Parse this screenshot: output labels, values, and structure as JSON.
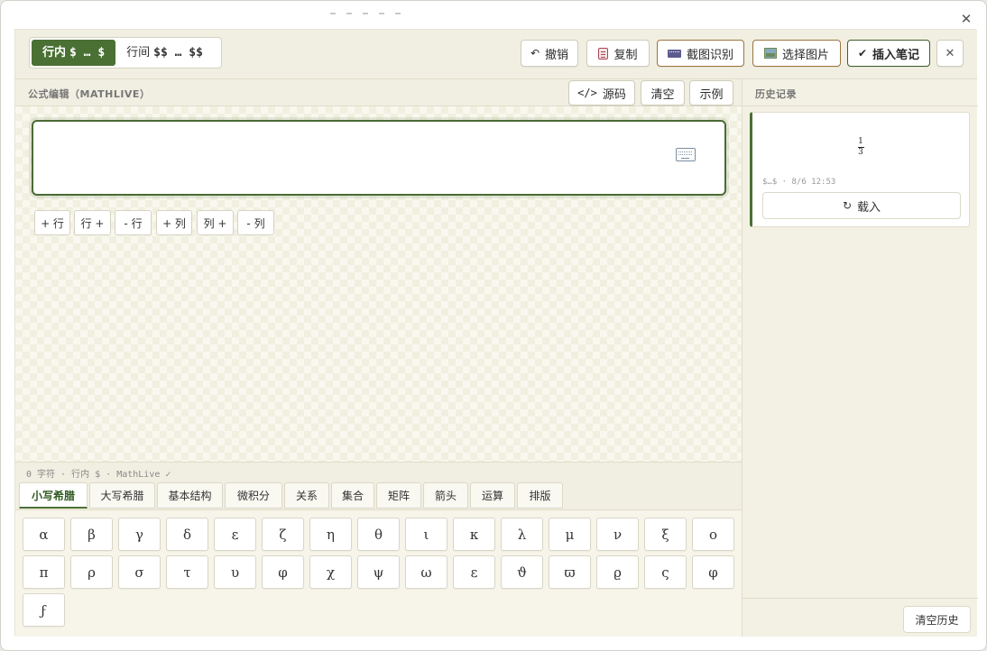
{
  "window": {
    "close_glyph": "✕"
  },
  "mode": {
    "inline": {
      "label": "行内",
      "math": "$ … $"
    },
    "display": {
      "label": "行间",
      "math": "$$ … $$"
    }
  },
  "toolbar": {
    "undo": "撤销",
    "copy": "复制",
    "ocr": "截图识别",
    "pick_image": "选择图片",
    "insert_note": "插入笔记",
    "close_glyph": "✕",
    "undo_icon": "↶",
    "check_icon": "✔"
  },
  "editor": {
    "section_label": "公式编辑（MATHLIVE）",
    "source_icon": "</>",
    "source": "源码",
    "clear": "清空",
    "example": "示例",
    "matrix_buttons": [
      "+ 行",
      "行 +",
      "- 行",
      "+ 列",
      "列 +",
      "- 列"
    ],
    "status": "0 字符 · 行内 $ · MathLive ✓"
  },
  "symbol_tabs": [
    "小写希腊",
    "大写希腊",
    "基本结构",
    "微积分",
    "关系",
    "集合",
    "矩阵",
    "箭头",
    "运算",
    "排版"
  ],
  "symbol_keys": [
    "α",
    "β",
    "γ",
    "δ",
    "ε",
    "ζ",
    "η",
    "θ",
    "ι",
    "κ",
    "λ",
    "μ",
    "ν",
    "ξ",
    "ο",
    "π",
    "ρ",
    "σ",
    "τ",
    "υ",
    "φ",
    "χ",
    "ψ",
    "ω",
    "ε",
    "ϑ",
    "ϖ",
    "ϱ",
    "ς",
    "φ",
    "ϝ"
  ],
  "history": {
    "title": "历史记录",
    "items": [
      {
        "frac_num": "1",
        "frac_den": "3",
        "meta": "$…$ · 8/6 12:53",
        "load_icon": "↻",
        "load_label": "载入"
      }
    ],
    "clear_label": "清空历史"
  }
}
